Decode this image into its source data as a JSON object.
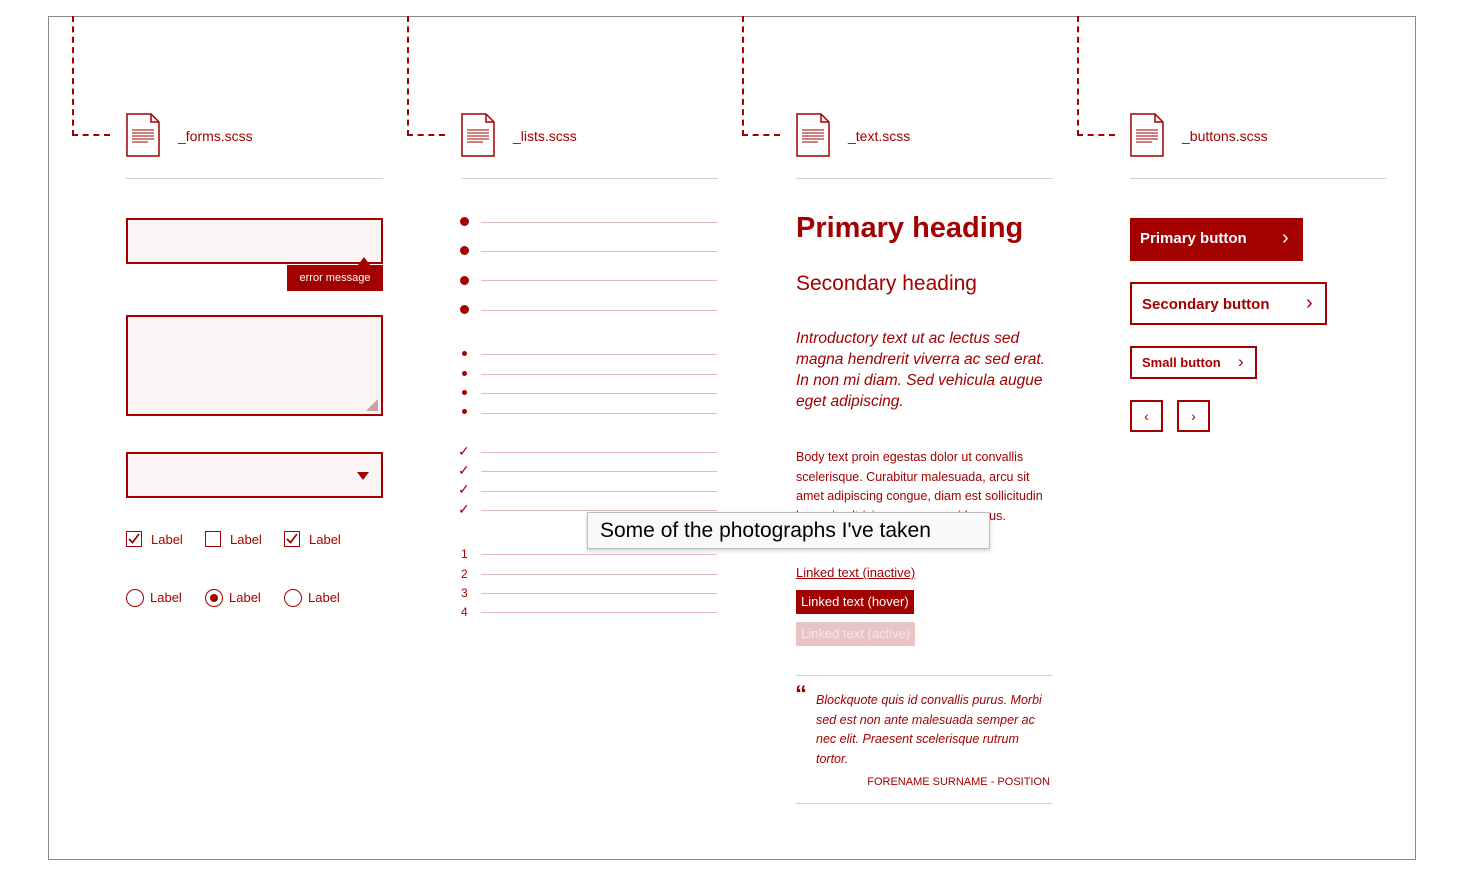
{
  "columns": {
    "forms": {
      "file": "_forms.scss"
    },
    "lists": {
      "file": "_lists.scss"
    },
    "text": {
      "file": "_text.scss"
    },
    "buttons": {
      "file": "_buttons.scss"
    }
  },
  "forms": {
    "error_message": "error message",
    "checkboxes": [
      {
        "label": "Label",
        "checked": true
      },
      {
        "label": "Label",
        "checked": false
      },
      {
        "label": "Label",
        "checked": true
      }
    ],
    "radios": [
      {
        "label": "Label",
        "selected": false
      },
      {
        "label": "Label",
        "selected": true
      },
      {
        "label": "Label",
        "selected": false
      }
    ]
  },
  "lists": {
    "ordered_numbers": [
      "1",
      "2",
      "3",
      "4"
    ]
  },
  "text": {
    "primary_heading": "Primary heading",
    "secondary_heading": "Secondary heading",
    "intro": "Introductory text ut ac lectus sed magna hendrerit viverra ac sed erat. In non mi diam. Sed vehicula augue eget adipiscing.",
    "body": "Body text proin egestas dolor ut convallis scelerisque. Curabitur malesuada, arcu sit amet adipiscing congue, diam est sollicitudin lacus, in ultricies urna neque id purus.",
    "link_inactive": "Linked text (inactive)",
    "link_hover": "Linked text (hover)",
    "link_active": "Linked text (active)",
    "blockquote": "Blockquote quis id convallis purus. Morbi sed est non ante malesuada semper ac nec elit. Praesent scelerisque rutrum tortor.",
    "cite": "FORENAME SURNAME - POSITION"
  },
  "buttons": {
    "primary": "Primary button",
    "secondary": "Secondary button",
    "small": "Small button",
    "chevron": "›",
    "prev": "‹",
    "next": "›"
  },
  "tooltip": "Some of the photographs I've taken",
  "colors": {
    "accent": "#a30000",
    "field_bg": "#fbf4f4",
    "rule": "#d3d3d3"
  }
}
